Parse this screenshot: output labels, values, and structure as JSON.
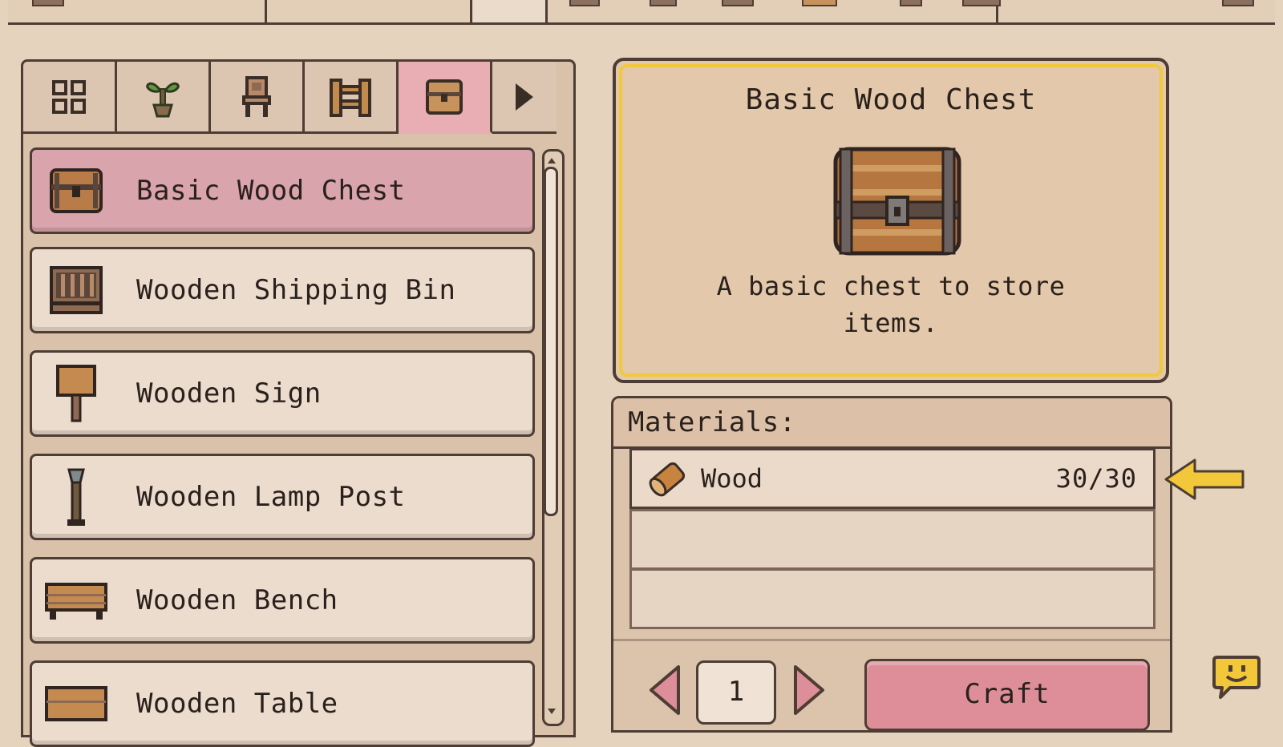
{
  "tabs": [
    {
      "icon": "grid-icon",
      "active": false
    },
    {
      "icon": "sapling-icon",
      "active": false
    },
    {
      "icon": "chair-icon",
      "active": false
    },
    {
      "icon": "fence-icon",
      "active": false
    },
    {
      "icon": "chest-icon",
      "active": true
    },
    {
      "icon": "next-arrow-icon",
      "active": false
    }
  ],
  "recipes": [
    {
      "label": "Basic Wood Chest",
      "icon": "chest-icon",
      "selected": true
    },
    {
      "label": "Wooden Shipping Bin",
      "icon": "shipping-bin-icon",
      "selected": false
    },
    {
      "label": "Wooden Sign",
      "icon": "sign-icon",
      "selected": false
    },
    {
      "label": "Wooden Lamp Post",
      "icon": "lamp-post-icon",
      "selected": false
    },
    {
      "label": "Wooden Bench",
      "icon": "bench-icon",
      "selected": false
    },
    {
      "label": "Wooden Table",
      "icon": "table-icon",
      "selected": false
    }
  ],
  "detail": {
    "title": "Basic Wood Chest",
    "description": "A basic chest to store items.",
    "icon": "chest-icon"
  },
  "materials": {
    "title": "Materials:",
    "items": [
      {
        "name": "Wood",
        "count": "30/30",
        "icon": "log-icon"
      }
    ]
  },
  "quantity": "1",
  "craft_label": "Craft",
  "colors": {
    "highlight": "#f0c93c",
    "selected": "#d9a4ac",
    "craft": "#dd8e98",
    "outline": "#4e3d34"
  }
}
